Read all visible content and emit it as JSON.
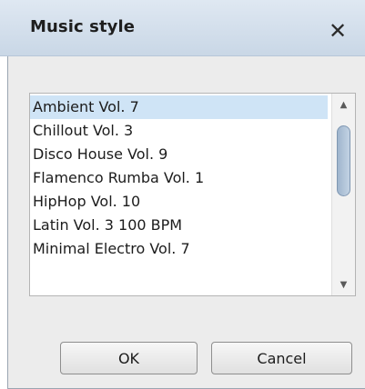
{
  "dialog": {
    "title": "Music style",
    "close_glyph": "✕"
  },
  "list": {
    "items": [
      "Ambient Vol. 7",
      "Chillout Vol. 3",
      "Disco House Vol. 9",
      "Flamenco Rumba Vol. 1",
      "HipHop Vol. 10",
      "Latin Vol. 3 100 BPM",
      "Minimal Electro Vol. 7"
    ],
    "selected_index": 0
  },
  "scrollbar": {
    "up_glyph": "▲",
    "down_glyph": "▼"
  },
  "buttons": {
    "ok_label": "OK",
    "cancel_label": "Cancel"
  },
  "colors": {
    "selection": "#cfe4f6",
    "titlebar": "#c9d7e6",
    "content_bg": "#ececec"
  }
}
